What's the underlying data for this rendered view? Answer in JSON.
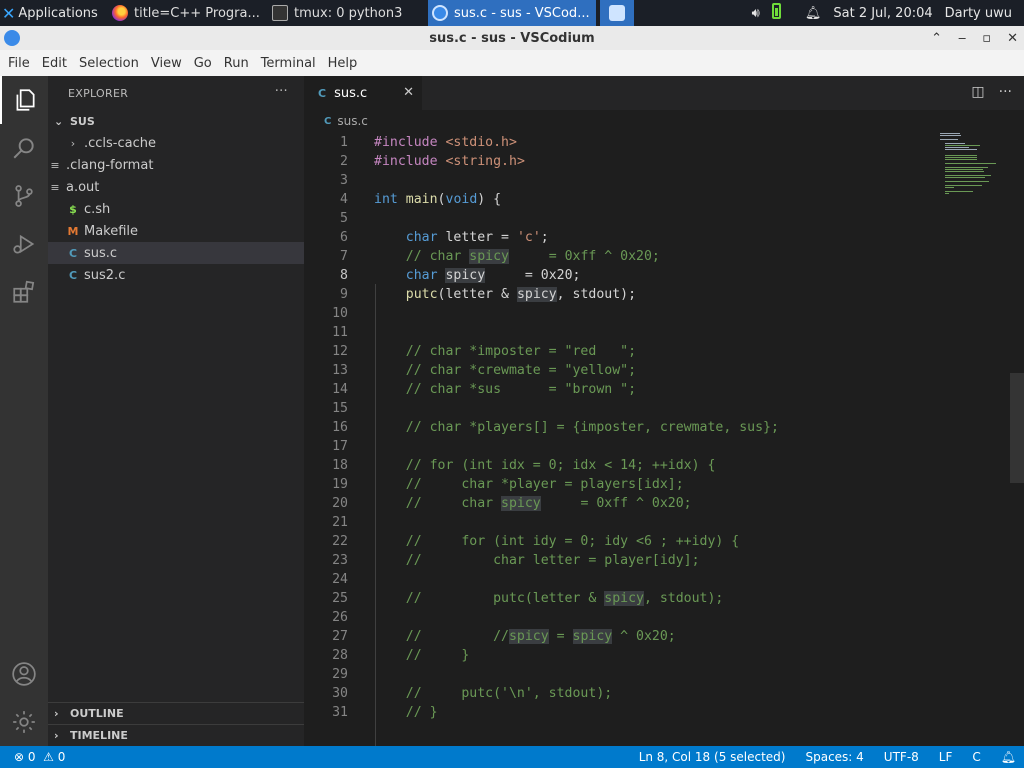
{
  "panel": {
    "applications": "Applications",
    "tasks": [
      {
        "label": "title=C++ Progra..."
      },
      {
        "label": "tmux: 0 python3"
      },
      {
        "label": "sus.c - sus - VSCod..."
      }
    ],
    "datetime": "Sat  2 Jul, 20:04",
    "user": "Darty uwu"
  },
  "window": {
    "title": "sus.c - sus - VSCodium"
  },
  "menu": [
    "File",
    "Edit",
    "Selection",
    "View",
    "Go",
    "Run",
    "Terminal",
    "Help"
  ],
  "sidebar": {
    "header": "EXPLORER",
    "folder": "SUS",
    "files": [
      {
        "name": ".ccls-cache",
        "icon": "chevron-right-icon"
      },
      {
        "name": ".clang-format",
        "icon": "list-icon"
      },
      {
        "name": "a.out",
        "icon": "list-icon"
      },
      {
        "name": "c.sh",
        "icon": "dollar-icon"
      },
      {
        "name": "Makefile",
        "icon": "makefile-icon"
      },
      {
        "name": "sus.c",
        "icon": "c-file-icon"
      },
      {
        "name": "sus2.c",
        "icon": "c-file-icon"
      }
    ],
    "outline": "OUTLINE",
    "timeline": "TIMELINE"
  },
  "editor": {
    "tab": "sus.c",
    "breadcrumb": "sus.c",
    "current_line": 8,
    "lines": [
      "#include <stdio.h>",
      "#include <string.h>",
      "",
      "int main(void) {",
      "",
      "    char letter = 'c';",
      "    // char spicy     = 0xff ^ 0x20;",
      "    char spicy     = 0x20;",
      "    putc(letter & spicy, stdout);",
      "",
      "",
      "    // char *imposter = \"red   \";",
      "    // char *crewmate = \"yellow\";",
      "    // char *sus      = \"brown \";",
      "",
      "    // char *players[] = {imposter, crewmate, sus};",
      "",
      "    // for (int idx = 0; idx < 14; ++idx) {",
      "    //     char *player = players[idx];",
      "    //     char spicy     = 0xff ^ 0x20;",
      "",
      "    //     for (int idy = 0; idy <6 ; ++idy) {",
      "    //         char letter = player[idy];",
      "",
      "    //         putc(letter & spicy, stdout);",
      "",
      "    //         //spicy = spicy ^ 0x20;",
      "    //     }",
      "",
      "    //     putc('\\n', stdout);",
      "    // }"
    ]
  },
  "status": {
    "errors": "0",
    "warnings": "0",
    "position": "Ln 8, Col 18 (5 selected)",
    "spaces": "Spaces: 4",
    "encoding": "UTF-8",
    "eol": "LF",
    "language": "C"
  },
  "colors": {
    "statusbar": "#007acc",
    "activitybar": "#333333",
    "sidebar": "#252526",
    "editor": "#1e1e1e"
  }
}
